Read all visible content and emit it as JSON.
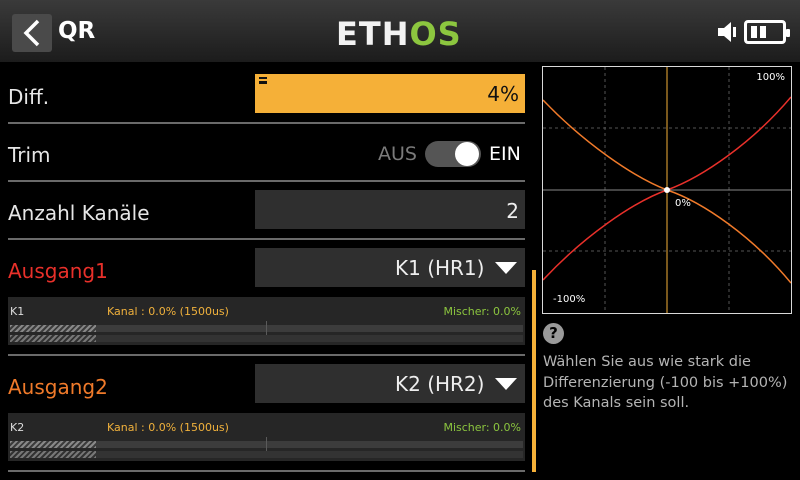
{
  "header": {
    "title": "QR",
    "logo_a": "ETH",
    "logo_b": "OS"
  },
  "form": {
    "diff": {
      "label": "Diff.",
      "value": "4%"
    },
    "trim": {
      "label": "Trim",
      "off_label": "AUS",
      "on_label": "EIN",
      "state": "on"
    },
    "channels": {
      "label": "Anzahl Kanäle",
      "value": "2"
    },
    "outputs": [
      {
        "label": "Ausgang1",
        "label_color": "#e8302a",
        "selected": "K1 (HR1)",
        "monitor": {
          "channel": "K1",
          "kanal": "Kanal : 0.0% (1500us)",
          "mischer": "Mischer: 0.0%"
        }
      },
      {
        "label": "Ausgang2",
        "label_color": "#f07a2a",
        "selected": "K2 (HR2)",
        "monitor": {
          "channel": "K2",
          "kanal": "Kanal : 0.0% (1500us)",
          "mischer": "Mischer: 0.0%"
        }
      }
    ]
  },
  "graph": {
    "label_top": "100%",
    "label_center": "0%",
    "label_bottom": "-100%",
    "curve_colors": [
      "#f07a2a",
      "#e8302a"
    ]
  },
  "help": {
    "icon": "question-icon",
    "text": "Wählen Sie aus wie stark die Differenzierung (-100 bis +100%) des Kanals sein soll."
  },
  "colors": {
    "accent": "#f5b038",
    "logo_green": "#8cc63f"
  }
}
